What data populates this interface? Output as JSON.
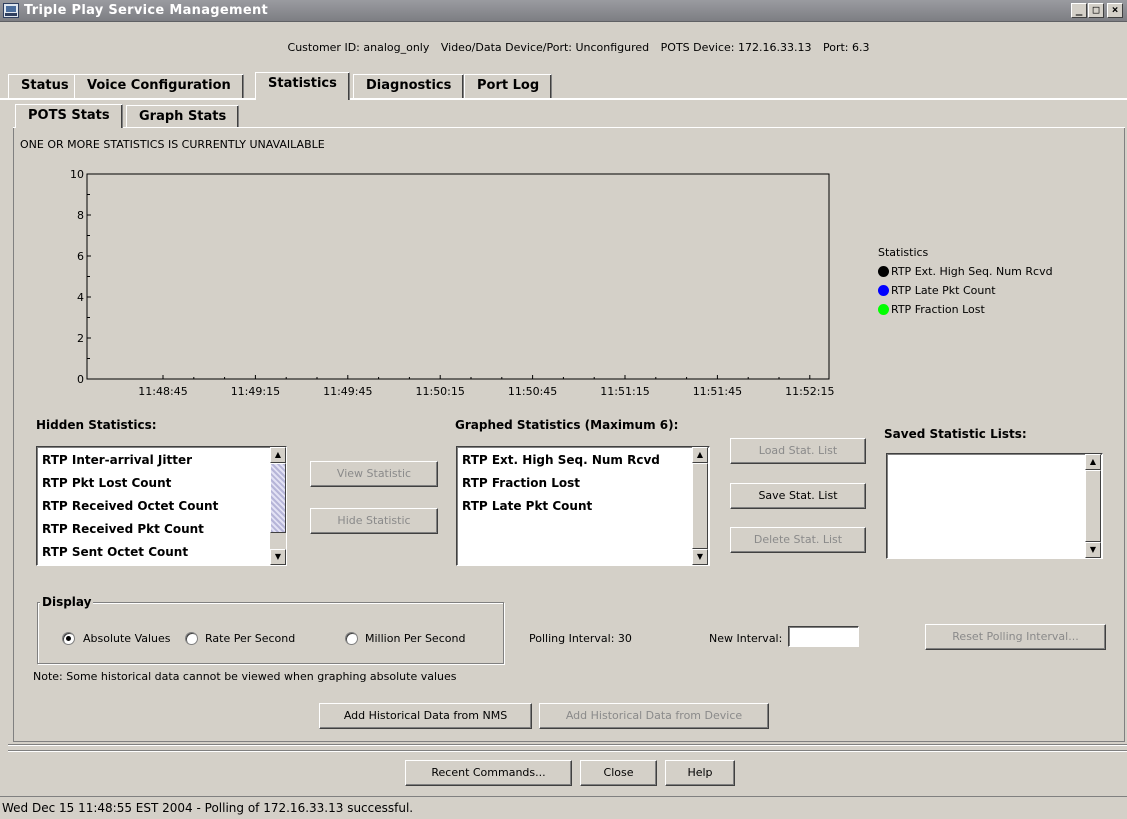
{
  "window": {
    "title": "Triple Play Service Management",
    "min_label": "_",
    "max_label": "□",
    "close_label": "×"
  },
  "info": {
    "customer": "Customer ID: analog_only",
    "video": "Video/Data Device/Port: Unconfigured",
    "pots_device": "POTS Device: 172.16.33.13",
    "port": "Port: 6.3"
  },
  "tabs": [
    {
      "label": "Status"
    },
    {
      "label": "Voice Configuration"
    },
    {
      "label": "Statistics"
    },
    {
      "label": "Diagnostics"
    },
    {
      "label": "Port Log"
    }
  ],
  "subtabs": [
    {
      "label": "POTS Stats"
    },
    {
      "label": "Graph Stats"
    }
  ],
  "message": "ONE OR MORE STATISTICS IS CURRENTLY UNAVAILABLE",
  "chart_data": {
    "type": "line",
    "title": "",
    "xlabel": "",
    "ylabel": "",
    "ylim": [
      0,
      10
    ],
    "y_ticks": [
      "0",
      "2",
      "4",
      "6",
      "8",
      "10"
    ],
    "x_ticks": [
      "11:48:45",
      "11:49:15",
      "11:49:45",
      "11:50:15",
      "11:50:45",
      "11:51:15",
      "11:51:45",
      "11:52:15"
    ],
    "legend_title": "Statistics",
    "legend_position": "right",
    "series": [
      {
        "name": "RTP Ext. High Seq. Num Rcvd",
        "color": "#000000",
        "values": []
      },
      {
        "name": "RTP Late Pkt Count",
        "color": "#0000ff",
        "values": []
      },
      {
        "name": "RTP Fraction Lost",
        "color": "#00ff00",
        "values": []
      }
    ]
  },
  "hidden": {
    "label": "Hidden Statistics:",
    "items": [
      "RTP Inter-arrival Jitter",
      "RTP Pkt Lost Count",
      "RTP Received Octet Count",
      "RTP Received Pkt Count",
      "RTP Sent Octet Count"
    ]
  },
  "graphed": {
    "label": "Graphed Statistics (Maximum 6):",
    "items": [
      "RTP Ext. High Seq. Num Rcvd",
      "RTP Fraction Lost",
      "RTP Late Pkt Count"
    ]
  },
  "saved": {
    "label": "Saved Statistic Lists:"
  },
  "buttons": {
    "view": "View Statistic",
    "hide": "Hide Statistic",
    "load": "Load Stat. List",
    "save": "Save Stat. List",
    "delete": "Delete Stat. List",
    "reset": "Reset Polling Interval...",
    "add_nms": "Add Historical Data from NMS",
    "add_device": "Add Historical Data from Device",
    "recent": "Recent Commands...",
    "close": "Close",
    "help": "Help"
  },
  "display": {
    "label": "Display",
    "options": [
      "Absolute Values",
      "Rate Per Second",
      "Million Per Second"
    ],
    "selected": "Absolute Values"
  },
  "polling": {
    "interval_label": "Polling Interval:  30",
    "new_label": "New Interval:",
    "new_value": ""
  },
  "note": "Note: Some historical data cannot be viewed when graphing absolute values",
  "status": "Wed Dec 15 11:48:55 EST 2004 - Polling of 172.16.33.13 successful."
}
